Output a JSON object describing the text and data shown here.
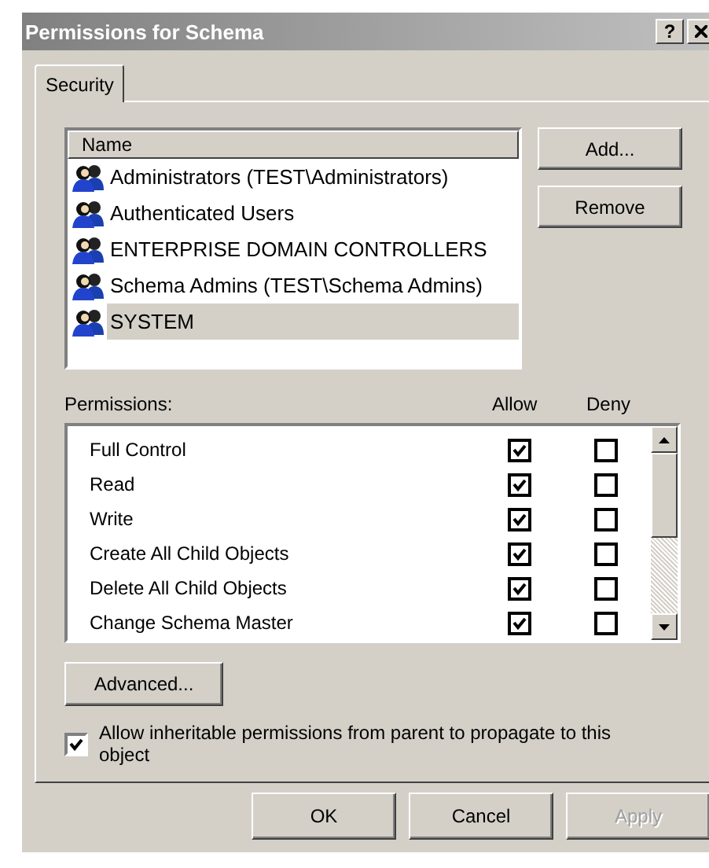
{
  "window": {
    "title": "Permissions for Schema",
    "help_button": "?"
  },
  "tabs": [
    {
      "label": "Security",
      "selected": true
    }
  ],
  "principals": {
    "column": "Name",
    "items": [
      {
        "name": "Administrators (TEST\\Administrators)",
        "selected": false
      },
      {
        "name": "Authenticated Users",
        "selected": false
      },
      {
        "name": "ENTERPRISE DOMAIN CONTROLLERS",
        "selected": false
      },
      {
        "name": "Schema Admins (TEST\\Schema Admins)",
        "selected": false
      },
      {
        "name": "SYSTEM",
        "selected": true
      }
    ]
  },
  "principal_buttons": [
    "Add...",
    "Remove"
  ],
  "permissions": {
    "label": "Permissions:",
    "allow_header": "Allow",
    "deny_header": "Deny",
    "rows": [
      {
        "name": "Full Control",
        "allow": true,
        "deny": false
      },
      {
        "name": "Read",
        "allow": true,
        "deny": false
      },
      {
        "name": "Write",
        "allow": true,
        "deny": false
      },
      {
        "name": "Create All Child Objects",
        "allow": true,
        "deny": false
      },
      {
        "name": "Delete All Child Objects",
        "allow": true,
        "deny": false
      },
      {
        "name": "Change Schema Master",
        "allow": true,
        "deny": false
      }
    ]
  },
  "advanced_button": "Advanced...",
  "inherit": {
    "label": "Allow inheritable permissions from parent to propagate to this object",
    "checked": true
  },
  "dialog_buttons": [
    {
      "label": "OK",
      "disabled": false
    },
    {
      "label": "Cancel",
      "disabled": false
    },
    {
      "label": "Apply",
      "disabled": true
    }
  ]
}
